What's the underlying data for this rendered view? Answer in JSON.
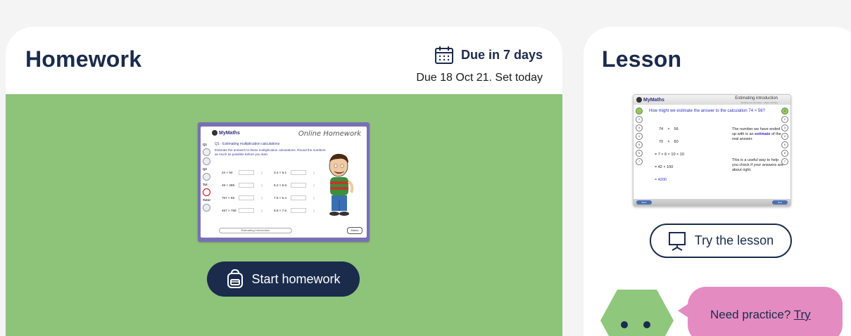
{
  "homework": {
    "title": "Homework",
    "due_main": "Due in 7 days",
    "due_sub": "Due 18 Oct 21. Set today",
    "start_label": "Start homework",
    "thumbnail": {
      "logo": "MyMaths",
      "banner": "Online Homework",
      "question_title": "Q1 - Estimating multiplication calculations",
      "instruction": "Estimate the answers to these multiplication calculations. Round the numbers as much as possible before you start.",
      "side_labels": [
        "Q1",
        "Q2",
        "Tut",
        "Tutor"
      ],
      "rows": [
        [
          "24 × 94",
          "3.2 × 6.1"
        ],
        [
          "49 × 288",
          "5.2 × 5.6"
        ],
        [
          "757 × 65",
          "7.5 × 5.4"
        ],
        [
          "467 × 756",
          "9.6 × 7.6"
        ]
      ],
      "footer": "Estimating introduction",
      "marks": "Marks"
    }
  },
  "lesson": {
    "title": "Lesson",
    "try_label": "Try the lesson",
    "thumbnail": {
      "logo": "MyMaths",
      "title": "Estimating introduction",
      "subtitle": "Working out estimates - whole numbers",
      "question": "How might we estimate the answer to the calculation 74 × 56?",
      "lines": [
        "74    ×    56",
        "70    ×    60",
        "= 7 × 6 × 10 × 10",
        "= 42 × 100",
        "= 4200"
      ],
      "note1_a": "The number we have ended up with is an",
      "note1_b": "estimate",
      "note1_c": "of the real answer.",
      "note2": "This is a useful way to help you check if your answers are about right.",
      "nums": [
        "1",
        "2",
        "3",
        "4",
        "5",
        "6",
        "7"
      ],
      "back": "Back",
      "next": "Next"
    }
  },
  "practice": {
    "text": "Need practice?",
    "link": "Try"
  },
  "colors": {
    "navy": "#1a2b4c",
    "green_panel": "#8ec37a",
    "pink_bubble": "#e48cc2",
    "hex_green": "#8fc77c"
  },
  "icons": {
    "calendar": "calendar-icon",
    "backpack": "backpack-icon",
    "presentation": "presentation-board-icon"
  }
}
